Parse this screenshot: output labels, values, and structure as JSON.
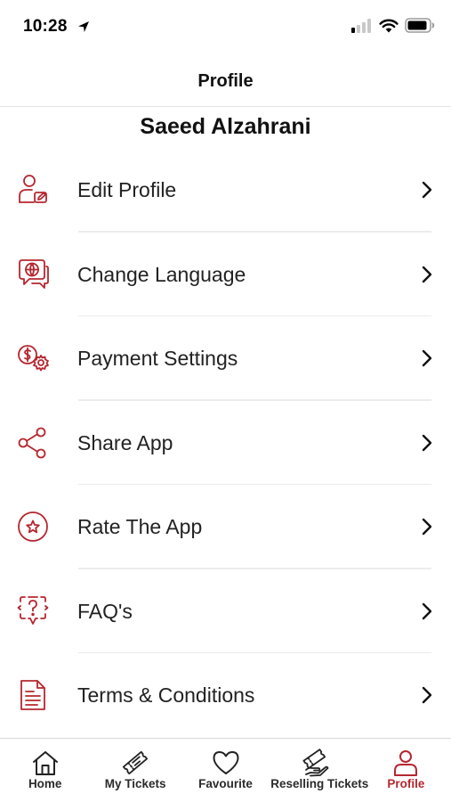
{
  "status_bar": {
    "time": "10:28",
    "icons": [
      "location-arrow-icon",
      "cellular-signal-icon",
      "wifi-icon",
      "battery-icon"
    ]
  },
  "header": {
    "title": "Profile"
  },
  "profile": {
    "name": "Saeed Alzahrani"
  },
  "menu": {
    "items": [
      {
        "label": "Edit Profile",
        "icon": "edit-profile-icon"
      },
      {
        "label": "Change Language",
        "icon": "language-globe-icon"
      },
      {
        "label": "Payment Settings",
        "icon": "payment-settings-icon"
      },
      {
        "label": "Share App",
        "icon": "share-icon"
      },
      {
        "label": "Rate The App",
        "icon": "star-icon"
      },
      {
        "label": "FAQ's",
        "icon": "question-bubble-icon"
      },
      {
        "label": "Terms & Conditions",
        "icon": "document-icon"
      }
    ]
  },
  "tab_bar": {
    "tabs": [
      {
        "label": "Home",
        "icon": "home-icon"
      },
      {
        "label": "My Tickets",
        "icon": "ticket-icon"
      },
      {
        "label": "Favourite",
        "icon": "heart-icon"
      },
      {
        "label": "Reselling Tickets",
        "icon": "resell-ticket-icon"
      },
      {
        "label": "Profile",
        "icon": "person-icon",
        "active": true
      }
    ]
  },
  "colors": {
    "accent": "#b5272f",
    "text": "#222222",
    "divider": "#ececec"
  }
}
